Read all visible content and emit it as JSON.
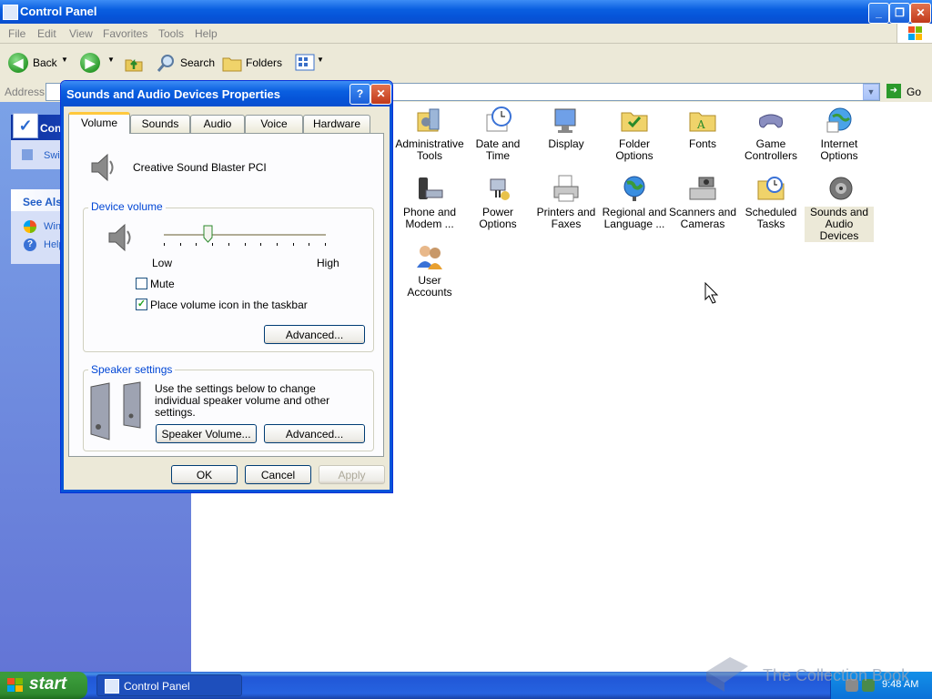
{
  "window": {
    "title": "Control Panel",
    "minimize": "_",
    "restore": "❐",
    "close": "✕"
  },
  "menu": [
    "File",
    "Edit",
    "View",
    "Favorites",
    "Tools",
    "Help"
  ],
  "toolbar": {
    "back": "Back",
    "search": "Search",
    "folders": "Folders"
  },
  "address": {
    "label": "Address",
    "go": "Go"
  },
  "taskpane": {
    "control_panel_title": "Con",
    "switch_link": "Swi",
    "see_also_title": "See Als",
    "see_also_items": [
      "Win",
      "Help"
    ]
  },
  "control_panel_items": [
    {
      "label": "Administrative Tools",
      "icon": "admin-tools-icon"
    },
    {
      "label": "Date and Time",
      "icon": "date-time-icon"
    },
    {
      "label": "Display",
      "icon": "display-icon"
    },
    {
      "label": "Folder Options",
      "icon": "folder-options-icon"
    },
    {
      "label": "Fonts",
      "icon": "fonts-icon"
    },
    {
      "label": "Game Controllers",
      "icon": "game-controllers-icon"
    },
    {
      "label": "Internet Options",
      "icon": "internet-options-icon"
    },
    {
      "label": "Phone and Modem ...",
      "icon": "phone-modem-icon"
    },
    {
      "label": "Power Options",
      "icon": "power-options-icon"
    },
    {
      "label": "Printers and Faxes",
      "icon": "printers-faxes-icon"
    },
    {
      "label": "Regional and Language ...",
      "icon": "regional-language-icon"
    },
    {
      "label": "Scanners and Cameras",
      "icon": "scanners-cameras-icon"
    },
    {
      "label": "Scheduled Tasks",
      "icon": "scheduled-tasks-icon"
    },
    {
      "label": "Sounds and Audio Devices",
      "icon": "sounds-audio-icon",
      "selected": true
    },
    {
      "label": "User Accounts",
      "icon": "user-accounts-icon"
    }
  ],
  "dialog": {
    "title": "Sounds and Audio Devices Properties",
    "help": "?",
    "close": "✕",
    "tabs": [
      "Volume",
      "Sounds",
      "Audio",
      "Voice",
      "Hardware"
    ],
    "active_tab": "Volume",
    "device_name": "Creative Sound Blaster PCI",
    "device_volume_label": "Device volume",
    "slider_low": "Low",
    "slider_high": "High",
    "slider_level": 0.27,
    "mute_label": "Mute",
    "mute_checked": false,
    "taskbar_icon_label": "Place volume icon in the taskbar",
    "taskbar_icon_checked": true,
    "advanced_button": "Advanced...",
    "speaker_settings_label": "Speaker settings",
    "speaker_text": "Use the settings below to change individual speaker volume and other settings.",
    "speaker_volume_button": "Speaker Volume...",
    "speaker_advanced_button": "Advanced...",
    "ok": "OK",
    "cancel": "Cancel",
    "apply": "Apply"
  },
  "taskbar": {
    "start": "start",
    "task_item": "Control Panel",
    "clock": "9:48 AM"
  },
  "watermark": "The Collection Book"
}
